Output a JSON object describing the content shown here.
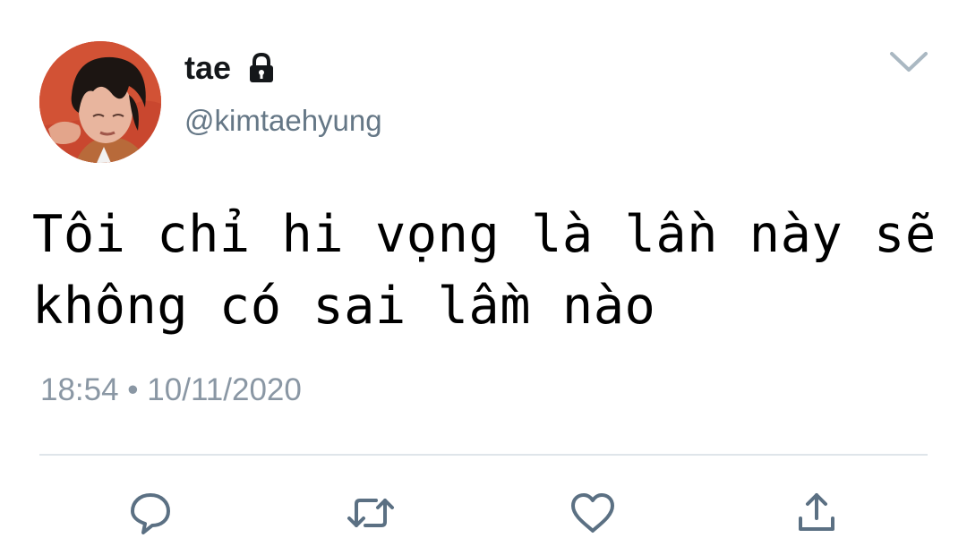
{
  "user": {
    "display_name": "tae",
    "handle": "@kimtaehyung",
    "protected_icon": "lock-icon",
    "avatar_colors": {
      "background": "#c9472f",
      "hair": "#1c1512",
      "skin": "#e8b59e",
      "shirt": "#b86a3a"
    }
  },
  "tweet": {
    "text": "Tôi chỉ hi vọng là lần này sẽ\nkhông có sai lầm nào",
    "timestamp": "18:54 • 10/11/2020"
  },
  "menu": {
    "caret_icon": "chevron-down-icon"
  },
  "actions": [
    {
      "name": "reply",
      "icon": "speech-bubble-icon"
    },
    {
      "name": "retweet",
      "icon": "retweet-icon"
    },
    {
      "name": "like",
      "icon": "heart-icon"
    },
    {
      "name": "share",
      "icon": "share-icon"
    }
  ],
  "colors": {
    "primary_text": "#14171a",
    "secondary_text": "#657786",
    "timestamp_text": "#8a97a4",
    "divider": "#dfe5ea",
    "icon": "#5b7083"
  }
}
